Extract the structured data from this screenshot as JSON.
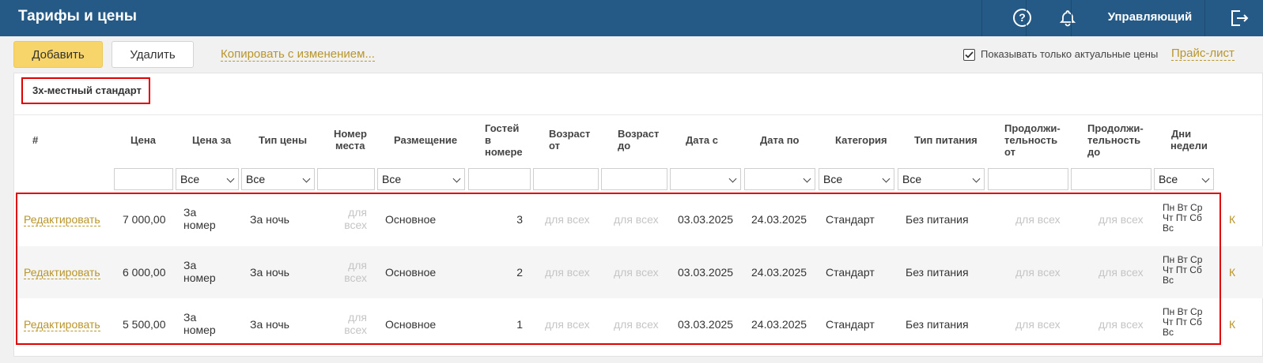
{
  "header": {
    "title": "Тарифы и цены",
    "help_glyph": "?",
    "user_label": "Управляющий"
  },
  "toolbar": {
    "add_label": "Добавить",
    "delete_label": "Удалить",
    "copy_label": "Копировать с изменением...",
    "checkbox_label": "Показывать только актуальные цены",
    "checkbox_checked": true,
    "pricelist_label": "Прайс-лист"
  },
  "room": {
    "name": "3х-местный стандарт"
  },
  "table": {
    "columns": {
      "num": "#",
      "price": "Цена",
      "price_for": "Цена за",
      "price_type": "Тип цены",
      "seat_line1": "Номер",
      "seat_line2": "места",
      "placement": "Размещение",
      "guests_line1": "Гостей",
      "guests_line2": "в",
      "guests_line3": "номере",
      "agefrom_line1": "Возраст",
      "agefrom_line2": "от",
      "ageto_line1": "Возраст",
      "ageto_line2": "до",
      "date_from": "Дата с",
      "date_to": "Дата по",
      "category": "Категория",
      "meal": "Тип питания",
      "durfrom_line1": "Продолжи-",
      "durfrom_line2": "тельность",
      "durfrom_line3": "от",
      "durto_line1": "Продолжи-",
      "durto_line2": "тельность",
      "durto_line3": "до",
      "days_line1": "Дни",
      "days_line2": "недели"
    },
    "filters": {
      "price_for": "Все",
      "price_type": "Все",
      "placement": "Все",
      "category": "Все",
      "meal": "Все",
      "days": "Все"
    },
    "rows": [
      {
        "edit": "Редактировать",
        "price": "7 000,00",
        "price_for_1": "За",
        "price_for_2": "номер",
        "price_type": "За ночь",
        "seat_1": "для",
        "seat_2": "всех",
        "placement": "Основное",
        "guests": "3",
        "age_from": "для всех",
        "age_to": "для всех",
        "date_from": "03.03.2025",
        "date_to": "24.03.2025",
        "category": "Стандарт",
        "meal": "Без питания",
        "dur_from": "для всех",
        "dur_to": "для всех",
        "days_1": "Пн Вт Ср",
        "days_2": "Чт Пт Сб",
        "days_3": "Вс",
        "edge": "К"
      },
      {
        "edit": "Редактировать",
        "price": "6 000,00",
        "price_for_1": "За",
        "price_for_2": "номер",
        "price_type": "За ночь",
        "seat_1": "для",
        "seat_2": "всех",
        "placement": "Основное",
        "guests": "2",
        "age_from": "для всех",
        "age_to": "для всех",
        "date_from": "03.03.2025",
        "date_to": "24.03.2025",
        "category": "Стандарт",
        "meal": "Без питания",
        "dur_from": "для всех",
        "dur_to": "для всех",
        "days_1": "Пн Вт Ср",
        "days_2": "Чт Пт Сб",
        "days_3": "Вс",
        "edge": "К"
      },
      {
        "edit": "Редактировать",
        "price": "5 500,00",
        "price_for_1": "За",
        "price_for_2": "номер",
        "price_type": "За ночь",
        "seat_1": "для",
        "seat_2": "всех",
        "placement": "Основное",
        "guests": "1",
        "age_from": "для всех",
        "age_to": "для всех",
        "date_from": "03.03.2025",
        "date_to": "24.03.2025",
        "category": "Стандарт",
        "meal": "Без питания",
        "dur_from": "для всех",
        "dur_to": "для всех",
        "days_1": "Пн Вт Ср",
        "days_2": "Чт Пт Сб",
        "days_3": "Вс",
        "edge": "К"
      }
    ]
  },
  "colors": {
    "header_bg": "#255a87",
    "accent_link": "#b9962b",
    "add_button": "#f7d56a",
    "highlight_red": "#e00000"
  },
  "icons": [
    "help-icon",
    "bell-icon",
    "logout-icon",
    "checkbox-checked-icon",
    "chevron-down-icon"
  ]
}
